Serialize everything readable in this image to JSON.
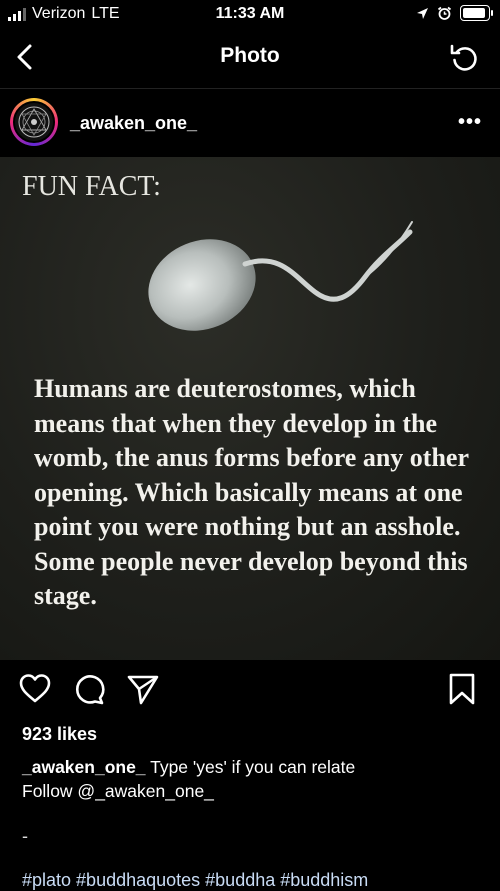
{
  "status_bar": {
    "carrier": "Verizon",
    "network": "LTE",
    "time": "11:33 AM"
  },
  "nav": {
    "title": "Photo"
  },
  "post": {
    "username": "_awaken_one_",
    "image": {
      "heading": "FUN FACT:",
      "text": "Humans are deuterostomes, which means that when they develop in the womb, the anus forms before any other opening. Which basically means at one point you were nothing but an asshole. Some people never develop beyond this stage."
    },
    "likes": "923 likes",
    "caption": {
      "username": "_awaken_one_",
      "text": "Type 'yes' if you can relate",
      "follow_line": "Follow @_awaken_one_",
      "separator": "-",
      "hashtags": "#plato #buddhaquotes #buddha #buddhism"
    }
  }
}
